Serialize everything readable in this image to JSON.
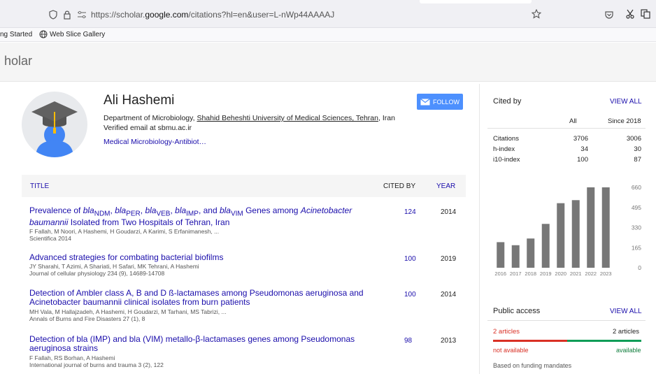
{
  "browser": {
    "url_prefix": "https://scholar.",
    "url_domain": "google.com",
    "url_suffix": "/citations?hl=en&user=L-nWp44AAAAJ",
    "bookmarks": [
      "ng Started",
      "Web Slice Gallery"
    ]
  },
  "header": {
    "brand": "holar"
  },
  "profile": {
    "name": "Ali Hashemi",
    "affiliation_prefix": "Department of Microbiology, ",
    "affiliation_link": "Shahid Beheshti University of Medical Sciences, Tehran",
    "affiliation_suffix": ", Iran",
    "verified": "Verified email at sbmu.ac.ir",
    "interest": "Medical Microbiology-Antibiot…",
    "follow_label": "FOLLOW"
  },
  "table": {
    "col_title": "TITLE",
    "col_cited": "CITED BY",
    "col_year": "YEAR",
    "rows": [
      {
        "title_html": "Prevalence of <i>bla</i><sub>NDM</sub>, <i>bla</i><sub>PER</sub>, <i>bla</i><sub>VEB</sub>, <i>bla</i><sub>IMP</sub>, and <i>bla</i><sub>VIM</sub> Genes among <i>Acinetobacter baumannii</i> Isolated from Two Hospitals of Tehran, Iran",
        "authors": "F Fallah, M Noori, A Hashemi, H Goudarzi, A Karimi, S Erfanimanesh, ...",
        "venue": "Scientifica 2014",
        "cited": "124",
        "year": "2014"
      },
      {
        "title_html": "Advanced strategies for combating bacterial biofilms",
        "authors": "JY Sharahi, T Azimi, A Shariati, H Safari, MK Tehrani, A Hashemi",
        "venue": "Journal of cellular physiology 234 (9), 14689-14708",
        "cited": "100",
        "year": "2019"
      },
      {
        "title_html": "Detection of Ambler class A, B and D ß-lactamases among Pseudomonas aeruginosa and Acinetobacter baumannii clinical isolates from burn patients",
        "authors": "MH Vala, M Hallajzadeh, A Hashemi, H Goudarzi, M Tarhani, MS Tabrizi, ...",
        "venue": "Annals of Burns and Fire Disasters 27 (1), 8",
        "cited": "100",
        "year": "2014"
      },
      {
        "title_html": "Detection of bla (IMP) and bla (VIM) metallo-β-lactamases genes among Pseudomonas aeruginosa strains",
        "authors": "F Fallah, RS Borhan, A Hashemi",
        "venue": "International journal of burns and trauma 3 (2), 122",
        "cited": "98",
        "year": "2013"
      }
    ]
  },
  "sidebar": {
    "cited_by": "Cited by",
    "view_all": "VIEW ALL",
    "col_all": "All",
    "col_since": "Since 2018",
    "stats": [
      {
        "label": "Citations",
        "all": "3706",
        "since": "3006"
      },
      {
        "label": "h-index",
        "all": "34",
        "since": "30"
      },
      {
        "label": "i10-index",
        "all": "100",
        "since": "87"
      }
    ],
    "public_access": "Public access",
    "pa_view_all": "VIEW ALL",
    "pa_left_count": "2 articles",
    "pa_right_count": "2 articles",
    "pa_not_available": "not available",
    "pa_available": "available",
    "pa_funding": "Based on funding mandates"
  },
  "chart_data": {
    "type": "bar",
    "categories": [
      "2016",
      "2017",
      "2018",
      "2019",
      "2020",
      "2021",
      "2022",
      "2023"
    ],
    "values": [
      210,
      185,
      240,
      360,
      530,
      555,
      660,
      660
    ],
    "ylim": [
      0,
      660
    ],
    "yticks": [
      "660",
      "495",
      "330",
      "165",
      "0"
    ],
    "bar_color": "#777777"
  }
}
